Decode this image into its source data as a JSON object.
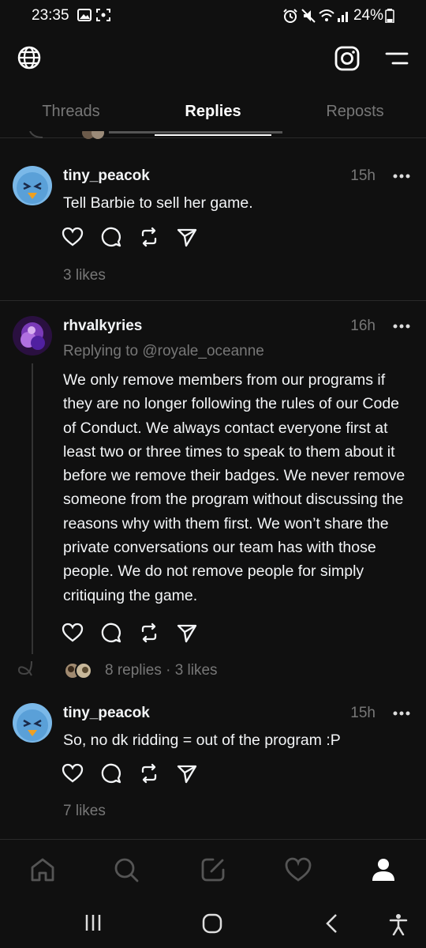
{
  "status_bar": {
    "time": "23:35",
    "battery": "24%"
  },
  "tabs": [
    {
      "label": "Threads"
    },
    {
      "label": "Replies"
    },
    {
      "label": "Reposts"
    }
  ],
  "posts": [
    {
      "username": "tiny_peacok",
      "time": "15h",
      "text": "Tell Barbie to sell her game.",
      "likes": "3 likes"
    },
    {
      "username": "rhvalkyries",
      "time": "16h",
      "replying_to": "Replying to @royale_oceanne",
      "text": "We only remove members from our programs if they are no longer following the rules of our Code of Conduct. We always contact everyone first at least two or three times to speak to them about it before we remove their badges. We never remove someone from the program without discussing the reasons why with them first. We won’t share the private conversations our team has with those people. We do not remove people for simply critiquing the game.",
      "stats": "8 replies · 3 likes"
    },
    {
      "username": "tiny_peacok",
      "time": "15h",
      "text": "So, no dk ridding = out of the program :P",
      "likes": "7 likes"
    }
  ],
  "colors": {
    "background": "#101010",
    "text": "#f3f5f7",
    "muted": "#777777",
    "divider": "#2a2a2a"
  }
}
